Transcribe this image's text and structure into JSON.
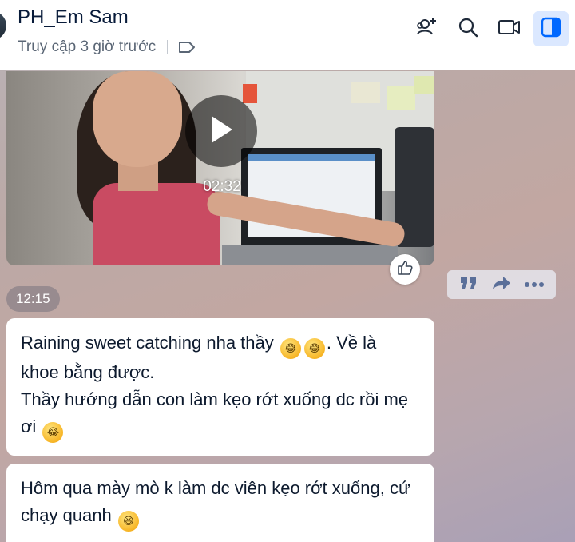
{
  "header": {
    "title": "PH_Em Sam",
    "status": "Truy cập 3 giờ trước",
    "actions": {
      "add_member_icon": "add-user-icon",
      "search_icon": "search-icon",
      "video_call_icon": "video-camera-icon",
      "panel_icon": "sidebar-panel-icon"
    }
  },
  "video_message": {
    "duration": "02:32"
  },
  "timestamp": "12:15",
  "messages": [
    {
      "line1": "Raining sweet catching nha thầy",
      "line1_end": ". Về là",
      "line2": "khoe bằng được.",
      "line3": "Thầy hướng dẫn con làm kẹo rớt xuống dc rồi mẹ",
      "line4": "ơi"
    },
    {
      "line1": "Hôm qua mày mò k làm dc viên kẹo rớt xuống, cứ",
      "line2": "chạy quanh"
    }
  ],
  "colors": {
    "accent": "#0068ff",
    "active_bg": "#dbe8ff",
    "text_primary": "#081b3a"
  }
}
